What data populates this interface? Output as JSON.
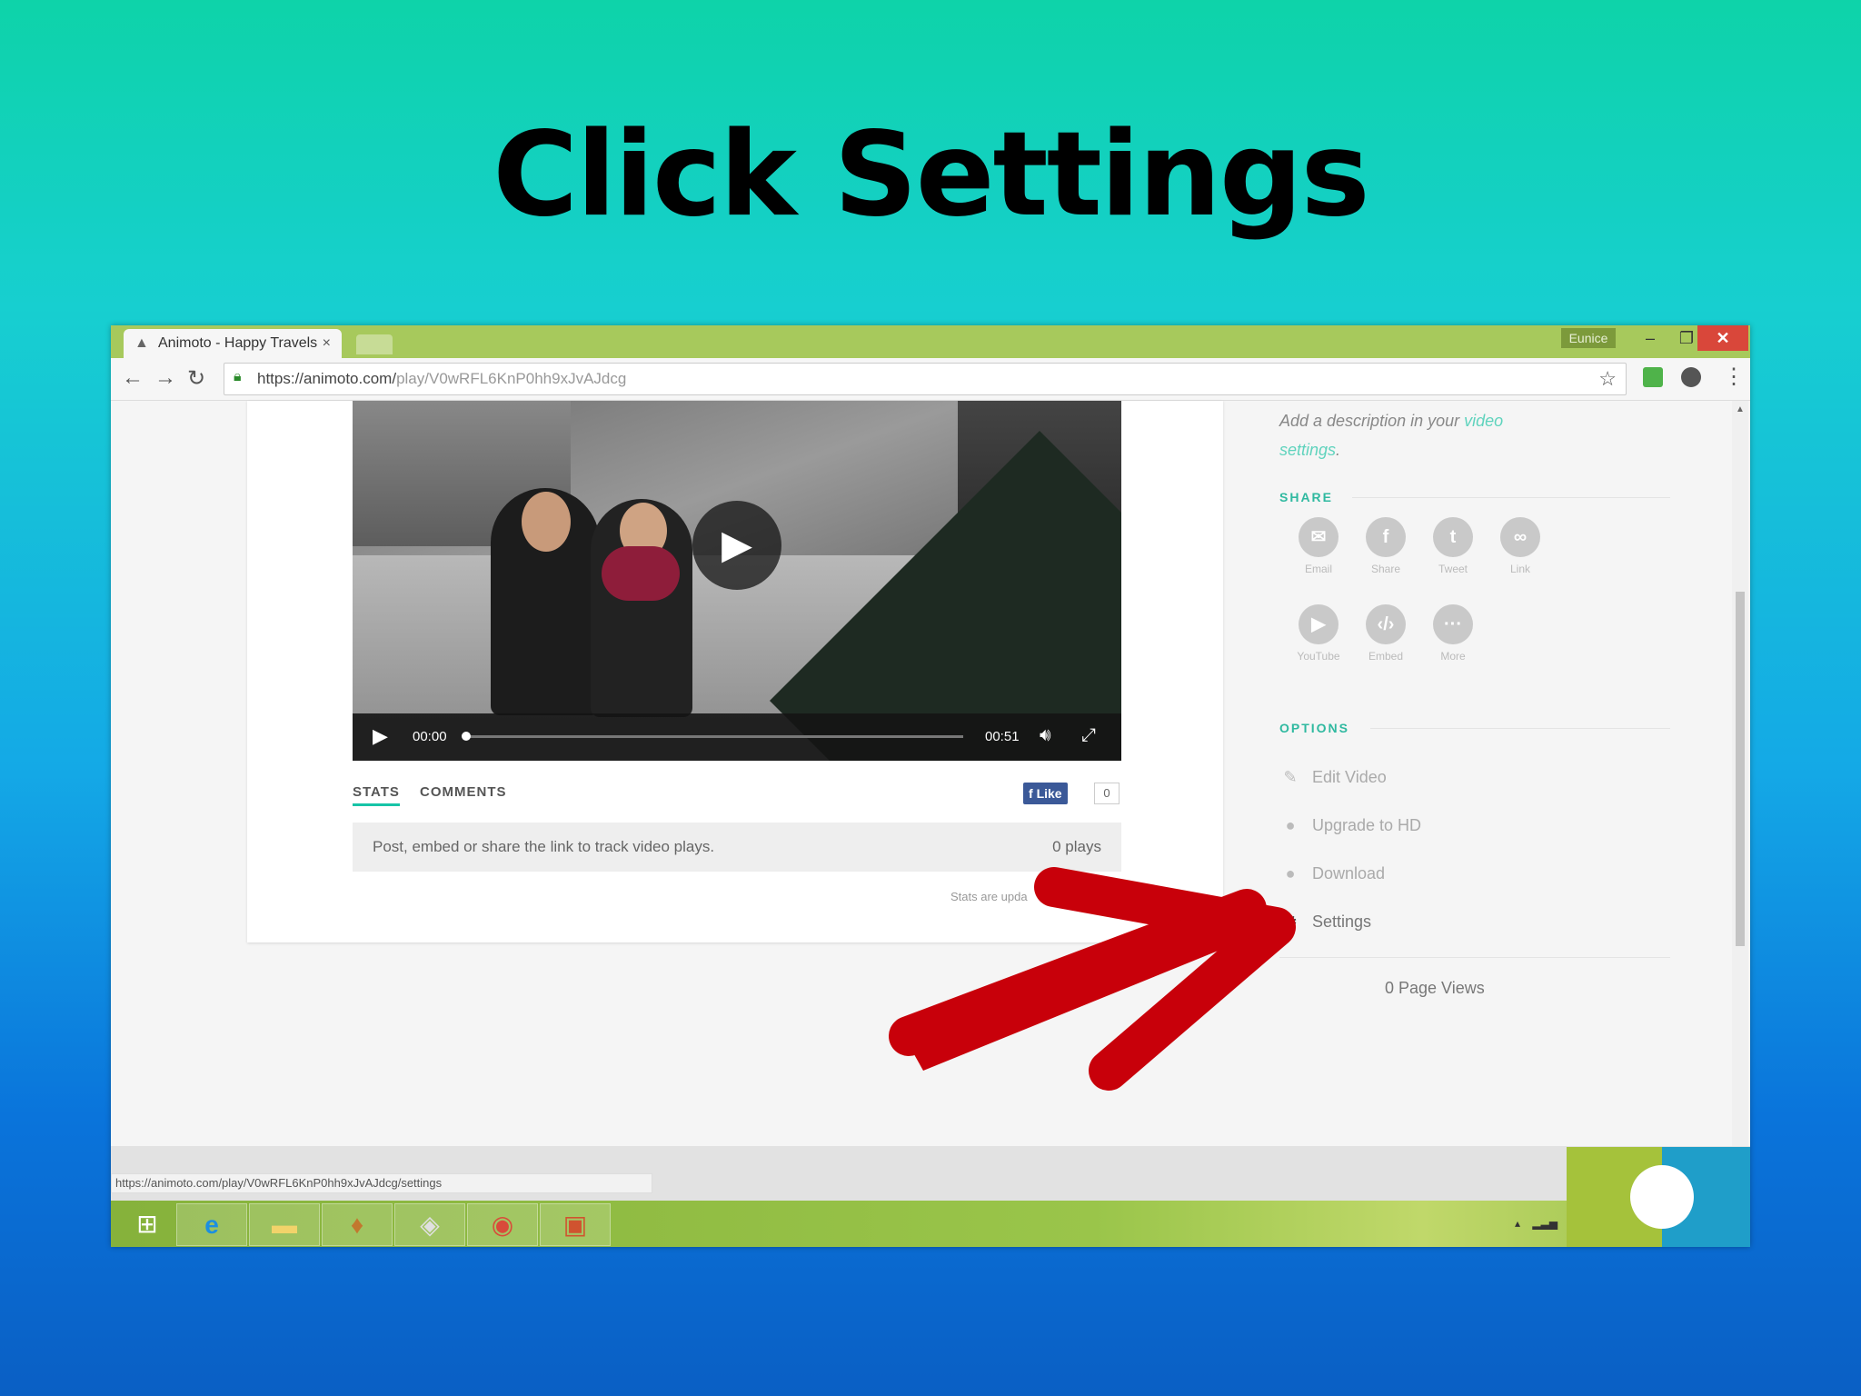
{
  "slide": {
    "title": "Click Settings"
  },
  "browser": {
    "tab_title": "Animoto - Happy Travels",
    "tab_close": "×",
    "user_name": "Eunice",
    "min_glyph": "–",
    "max_glyph": "❐",
    "close_glyph": "✕",
    "url_base": "https://animoto.com/",
    "url_path": "play/V0wRFL6KnP0hh9xJvAJdcg"
  },
  "video": {
    "time_current": "00:00",
    "time_total": "00:51",
    "progress": 0
  },
  "stats": {
    "tab_stats": "STATS",
    "tab_comments": "COMMENTS",
    "like_label": "Like",
    "like_count": "0",
    "message": "Post, embed or share the link to track video plays.",
    "plays": "0 plays",
    "updated_note": "Stats are upda"
  },
  "sidebar": {
    "desc_text": "Add a description in your ",
    "desc_link": "video settings",
    "desc_end": ".",
    "share_heading": "SHARE",
    "share_buttons": [
      {
        "label": "Email",
        "icon": "envelope-icon"
      },
      {
        "label": "Share",
        "icon": "facebook-icon"
      },
      {
        "label": "Tweet",
        "icon": "twitter-icon"
      },
      {
        "label": "Link",
        "icon": "link-icon"
      },
      {
        "label": "YouTube",
        "icon": "youtube-icon"
      },
      {
        "label": "Embed",
        "icon": "embed-icon"
      },
      {
        "label": "More",
        "icon": "more-icon"
      }
    ],
    "options_heading": "OPTIONS",
    "options": [
      {
        "label": "Edit Video",
        "icon": "pencil-icon"
      },
      {
        "label": "Upgrade to HD",
        "icon": "hd-icon"
      },
      {
        "label": "Download",
        "icon": "download-icon"
      },
      {
        "label": "Settings",
        "icon": "gear-icon"
      }
    ],
    "page_views": "0 Page Views"
  },
  "status_bar": {
    "url": "https://animoto.com/play/V0wRFL6KnP0hh9xJvAJdcg/settings"
  },
  "colors": {
    "accent": "#2fb9a0",
    "arrow": "#c8000a",
    "taskbar": "#9ac54a"
  }
}
